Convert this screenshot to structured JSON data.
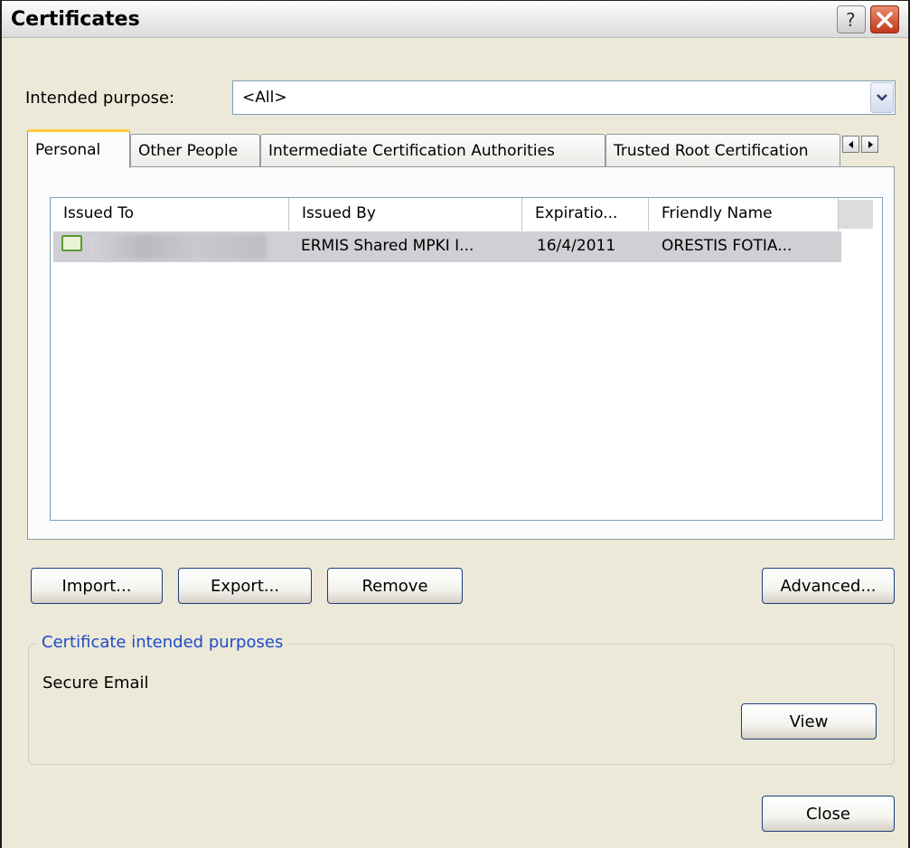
{
  "window": {
    "title": "Certificates"
  },
  "purpose": {
    "label": "Intended purpose:",
    "value": "<All>"
  },
  "tabs": [
    {
      "label": "Personal"
    },
    {
      "label": "Other People"
    },
    {
      "label": "Intermediate Certification Authorities"
    },
    {
      "label": "Trusted Root Certification"
    }
  ],
  "list": {
    "columns": [
      "Issued To",
      "Issued By",
      "Expiratio...",
      "Friendly Name"
    ],
    "rows": [
      {
        "issued_by": "ERMIS Shared MPKI I...",
        "expiration": "16/4/2011",
        "friendly_name": "ORESTIS FOTIA..."
      }
    ]
  },
  "buttons": {
    "import": "Import...",
    "export": "Export...",
    "remove": "Remove",
    "advanced": "Advanced...",
    "view": "View",
    "close": "Close"
  },
  "purposes_group": {
    "title": "Certificate intended purposes",
    "text": "Secure Email"
  },
  "colors": {
    "frame": "#ECE9D8",
    "active_tab_accent": "#FFC83C",
    "group_title": "#1F4BC8",
    "close_x": "#C1391B"
  }
}
